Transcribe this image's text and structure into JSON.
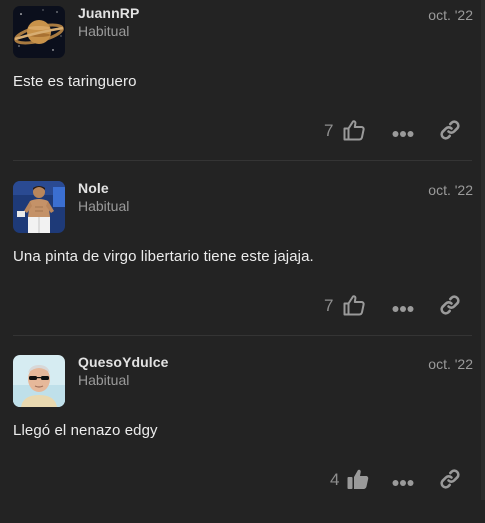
{
  "posts": [
    {
      "username": "JuannRP",
      "rank": "Habitual",
      "date": "oct. '22",
      "body": "Este es taringuero",
      "likes": "7",
      "liked": false,
      "avatar_icon": "saturn-avatar-icon"
    },
    {
      "username": "Nole",
      "rank": "Habitual",
      "date": "oct. '22",
      "body": "Una pinta de virgo libertario tiene este jajaja.",
      "likes": "7",
      "liked": false,
      "avatar_icon": "shirtless-tennis-player-avatar-icon"
    },
    {
      "username": "QuesoYdulce",
      "rank": "Habitual",
      "date": "oct. '22",
      "body": "Llegó el nenazo edgy",
      "likes": "4",
      "liked": true,
      "avatar_icon": "man-with-sunglasses-avatar-icon"
    }
  ],
  "colors": {
    "background": "#232323",
    "icon": "#9a9a9a",
    "text": "#ececec",
    "muted": "#9a9a9a"
  }
}
